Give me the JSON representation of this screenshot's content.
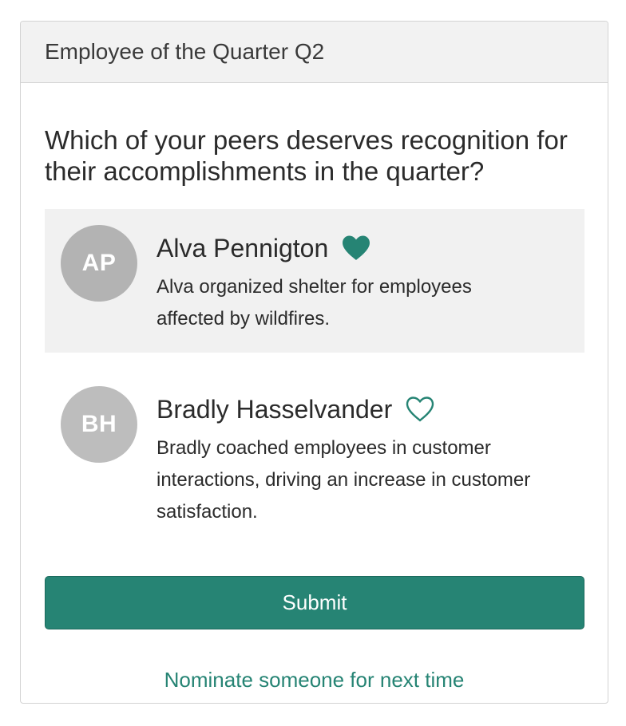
{
  "card": {
    "title": "Employee of the Quarter Q2"
  },
  "question": "Which of your peers deserves recognition for their accomplishments in the quarter?",
  "nominees": [
    {
      "initials": "AP",
      "name": "Alva Pennigton",
      "description": "Alva organized shelter for employees affected by wildfires.",
      "selected": true,
      "icon": "heart-filled-icon"
    },
    {
      "initials": "BH",
      "name": "Bradly Hasselvander",
      "description": "Bradly coached employees in customer interactions, driving an increase in customer satisfaction.",
      "selected": false,
      "icon": "heart-outline-icon"
    }
  ],
  "actions": {
    "submit_label": "Submit",
    "nominate_label": "Nominate someone for next time"
  },
  "colors": {
    "accent": "#268474",
    "selected_bg": "#f1f1f1",
    "avatar_bg": "#bdbdbd"
  }
}
